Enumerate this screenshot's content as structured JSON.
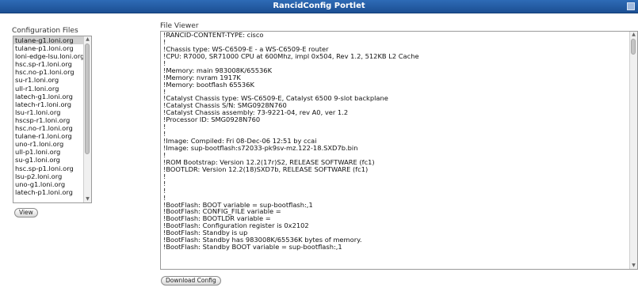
{
  "portlet": {
    "title": "RancidConfig Portlet"
  },
  "config_files": {
    "label": "Configuration Files",
    "selected_index": 0,
    "items": [
      "tulane-g1.loni.org",
      "tulane-p1.loni.org",
      "loni-edge-lsu.loni.org",
      "hsc.sp-r1.loni.org",
      "hsc.no-p1.loni.org",
      "su-r1.loni.org",
      "ull-r1.loni.org",
      "latech-g1.loni.org",
      "latech-r1.loni.org",
      "lsu-r1.loni.org",
      "hscsp-r1.loni.org",
      "hsc.no-r1.loni.org",
      "tulane-r1.loni.org",
      "uno-r1.loni.org",
      "ull-p1.loni.org",
      "su-g1.loni.org",
      "hsc.sp-p1.loni.org",
      "lsu-p2.loni.org",
      "uno-g1.loni.org",
      "latech-p1.loni.org"
    ],
    "view_button": "View"
  },
  "file_viewer": {
    "label": "File Viewer",
    "lines": [
      "!RANCID-CONTENT-TYPE: cisco",
      "!",
      "!Chassis type: WS-C6509-E - a WS-C6509-E router",
      "!CPU: R7000, SR71000 CPU at 600Mhz, impl 0x504, Rev 1.2, 512KB L2 Cache",
      "!",
      "!Memory: main 983008K/65536K",
      "!Memory: nvram 1917K",
      "!Memory: bootflash 65536K",
      "!",
      "!Catalyst Chassis type: WS-C6509-E, Catalyst 6500 9-slot backplane",
      "!Catalyst Chassis S/N: SMG0928N760",
      "!Catalyst Chassis assembly: 73-9221-04, rev A0, ver 1.2",
      "!Processor ID: SMG0928N760",
      "!",
      "!",
      "!Image: Compiled: Fri 08-Dec-06 12:51 by ccai",
      "!Image: sup-bootflash:s72033-pk9sv-mz.122-18.SXD7b.bin",
      "!",
      "!ROM Bootstrap: Version 12.2(17r)S2, RELEASE SOFTWARE (fc1)",
      "!BOOTLDR: Version 12.2(18)SXD7b, RELEASE SOFTWARE (fc1)",
      "!",
      "!",
      "!",
      "!",
      "!BootFlash: BOOT variable = sup-bootflash:,1",
      "!BootFlash: CONFIG_FILE variable =",
      "!BootFlash: BOOTLDR variable =",
      "!BootFlash: Configuration register is 0x2102",
      "!BootFlash: Standby is up",
      "!BootFlash: Standby has 983008K/65536K bytes of memory.",
      "!BootFlash: Standby BOOT variable = sup-bootflash:,1"
    ],
    "download_button": "Download Config"
  }
}
